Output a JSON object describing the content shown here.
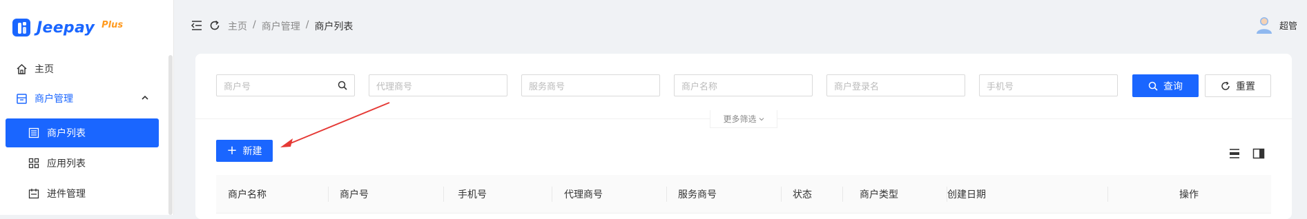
{
  "logo": {
    "text": "Jeepay",
    "plus": "Plus"
  },
  "sidebar": {
    "items": [
      {
        "label": "主页",
        "icon": "home-icon"
      },
      {
        "label": "商户管理",
        "icon": "merchant-icon"
      },
      {
        "label": "商户列表",
        "icon": "list-icon"
      },
      {
        "label": "应用列表",
        "icon": "grid-icon"
      },
      {
        "label": "进件管理",
        "icon": "calendar-icon"
      }
    ]
  },
  "breadcrumb": {
    "items": [
      "主页",
      "商户管理",
      "商户列表"
    ],
    "sep": "/"
  },
  "user": {
    "name": "超管"
  },
  "filters": {
    "merchant_no": "商户号",
    "agent_no": "代理商号",
    "service_no": "服务商号",
    "merchant_name": "商户名称",
    "login_name": "商户登录名",
    "phone": "手机号"
  },
  "buttons": {
    "query": "查询",
    "reset": "重置",
    "more": "更多筛选",
    "new": "新建"
  },
  "table": {
    "columns": [
      "商户名称",
      "商户号",
      "手机号",
      "代理商号",
      "服务商号",
      "状态",
      "商户类型",
      "创建日期",
      "操作"
    ]
  },
  "colors": {
    "primary": "#1a66ff",
    "accent": "#ff9a1f",
    "arrow": "#e53935"
  }
}
